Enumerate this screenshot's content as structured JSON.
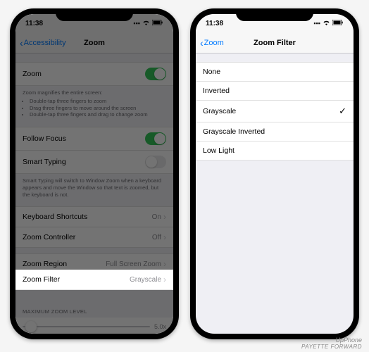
{
  "left": {
    "time": "11:38",
    "back_label": "Accessibility",
    "title": "Zoom",
    "zoom_label": "Zoom",
    "zoom_desc_head": "Zoom magnifies the entire screen:",
    "zoom_desc_items": [
      "Double-tap three fingers to zoom",
      "Drag three fingers to move around the screen",
      "Double-tap three fingers and drag to change zoom"
    ],
    "follow_focus_label": "Follow Focus",
    "smart_typing_label": "Smart Typing",
    "smart_typing_desc": "Smart Typing will switch to Window Zoom when a keyboard appears and move the Window so that text is zoomed, but the keyboard is not.",
    "keyboard_shortcuts_label": "Keyboard Shortcuts",
    "keyboard_shortcuts_value": "On",
    "zoom_controller_label": "Zoom Controller",
    "zoom_controller_value": "Off",
    "zoom_region_label": "Zoom Region",
    "zoom_region_value": "Full Screen Zoom",
    "zoom_filter_label": "Zoom Filter",
    "zoom_filter_value": "Grayscale",
    "max_zoom_header": "MAXIMUM ZOOM LEVEL",
    "max_zoom_value": "5.0x"
  },
  "right": {
    "time": "11:38",
    "back_label": "Zoom",
    "title": "Zoom Filter",
    "options": {
      "none": "None",
      "inverted": "Inverted",
      "grayscale": "Grayscale",
      "grayscale_inverted": "Grayscale Inverted",
      "low_light": "Low Light"
    },
    "selected": "grayscale"
  },
  "watermark": {
    "line1": "UpPhone",
    "line2": "PAYETTE FORWARD"
  }
}
